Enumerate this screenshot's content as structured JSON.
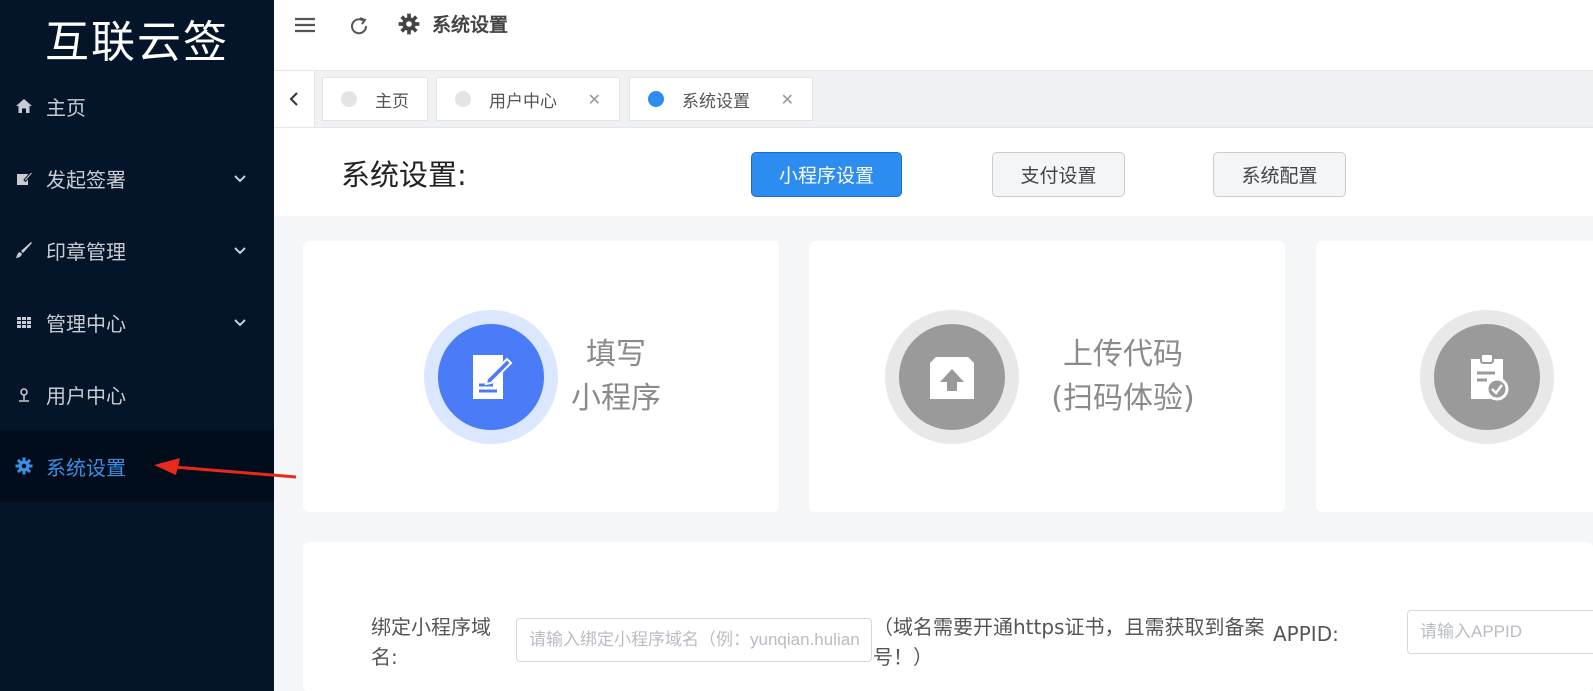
{
  "app": {
    "logo": "互联云签"
  },
  "sidebar": {
    "items": [
      {
        "label": "主页",
        "icon": "home-icon",
        "has_submenu": false
      },
      {
        "label": "发起签署",
        "icon": "edit-icon",
        "has_submenu": true
      },
      {
        "label": "印章管理",
        "icon": "brush-icon",
        "has_submenu": true
      },
      {
        "label": "管理中心",
        "icon": "grid-icon",
        "has_submenu": true
      },
      {
        "label": "用户中心",
        "icon": "user-icon",
        "has_submenu": false
      },
      {
        "label": "系统设置",
        "icon": "gear-icon",
        "has_submenu": false,
        "active": true
      }
    ]
  },
  "topbar": {
    "title": "系统设置"
  },
  "tabs": [
    {
      "label": "主页",
      "closable": false,
      "active": false
    },
    {
      "label": "用户中心",
      "closable": true,
      "active": false
    },
    {
      "label": "系统设置",
      "closable": true,
      "active": true
    }
  ],
  "header": {
    "title": "系统设置:",
    "buttons": [
      {
        "label": "小程序设置",
        "active": true
      },
      {
        "label": "支付设置",
        "active": false
      },
      {
        "label": "系统配置",
        "active": false
      }
    ]
  },
  "steps": [
    {
      "line1": "填写",
      "line2": "小程序",
      "icon": "document-edit-icon",
      "state": "active"
    },
    {
      "line1": "上传代码",
      "line2": "(扫码体验)",
      "icon": "upload-box-icon",
      "state": "inactive"
    },
    {
      "line1": "",
      "line2": "",
      "icon": "clipboard-check-icon",
      "state": "inactive"
    }
  ],
  "form": {
    "domain_label": "绑定小程序域名:",
    "domain_placeholder": "请输入绑定小程序域名（例：yunqian.hulianyunqian.com）",
    "domain_note": "（域名需要开通https证书，且需获取到备案号！）",
    "appid_label": "APPID:",
    "appid_placeholder": "请输入APPID"
  },
  "colors": {
    "sidebar_bg": "#04152a",
    "accent": "#2d8cf0",
    "arrow": "#e8291c"
  }
}
